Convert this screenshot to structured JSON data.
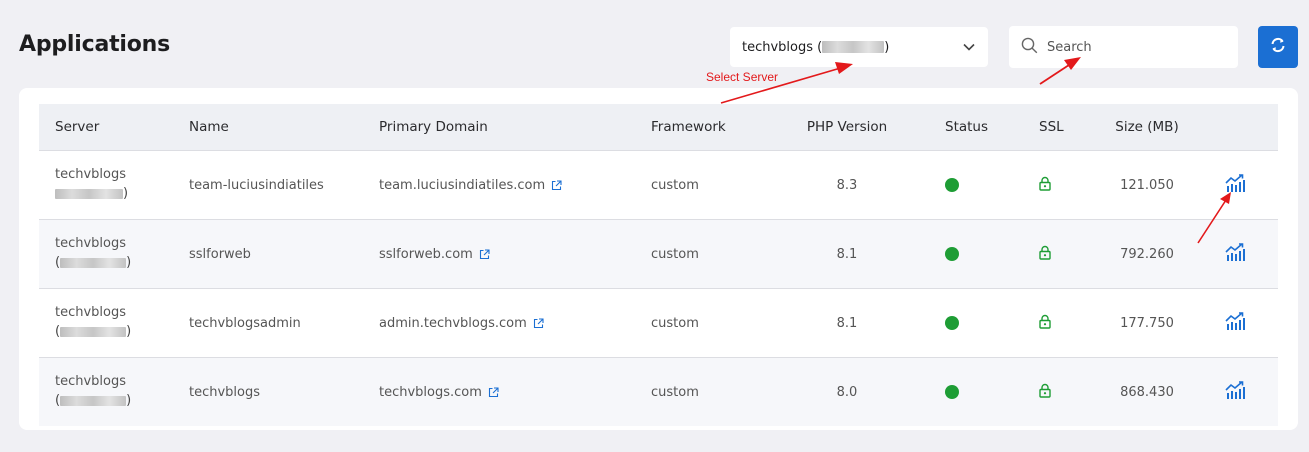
{
  "page": {
    "title": "Applications"
  },
  "server_select": {
    "value_prefix": "techvblogs (",
    "value_suffix": ")",
    "icon": "chevron-down-icon"
  },
  "search": {
    "placeholder": "Search",
    "value": "",
    "icon": "search-icon"
  },
  "refresh": {
    "icon": "refresh-icon",
    "color": "#1b6fd3"
  },
  "annotations": {
    "select_server": "Select Server",
    "color": "#e3191b"
  },
  "table": {
    "columns": [
      "Server",
      "Name",
      "Primary Domain",
      "Framework",
      "PHP Version",
      "Status",
      "SSL",
      "Size (MB)"
    ],
    "rows": [
      {
        "server_line1": "techvblogs",
        "server_line2_open": "",
        "server_line2_close": ")",
        "name": "team-luciusindiatiles",
        "domain": "team.luciusindiatiles.com",
        "framework": "custom",
        "php": "8.3",
        "status_color": "#1e9d35",
        "ssl_color": "#1e9d35",
        "size": "121.050"
      },
      {
        "server_line1": "techvblogs",
        "server_line2_open": "(",
        "server_line2_close": ")",
        "name": "sslforweb",
        "domain": "sslforweb.com",
        "framework": "custom",
        "php": "8.1",
        "status_color": "#1e9d35",
        "ssl_color": "#1e9d35",
        "size": "792.260"
      },
      {
        "server_line1": "techvblogs",
        "server_line2_open": "(",
        "server_line2_close": ")",
        "name": "techvblogsadmin",
        "domain": "admin.techvblogs.com",
        "framework": "custom",
        "php": "8.1",
        "status_color": "#1e9d35",
        "ssl_color": "#1e9d35",
        "size": "177.750"
      },
      {
        "server_line1": "techvblogs",
        "server_line2_open": "(",
        "server_line2_close": ")",
        "name": "techvblogs",
        "domain": "techvblogs.com",
        "framework": "custom",
        "php": "8.0",
        "status_color": "#1e9d35",
        "ssl_color": "#1e9d35",
        "size": "868.430"
      }
    ]
  }
}
